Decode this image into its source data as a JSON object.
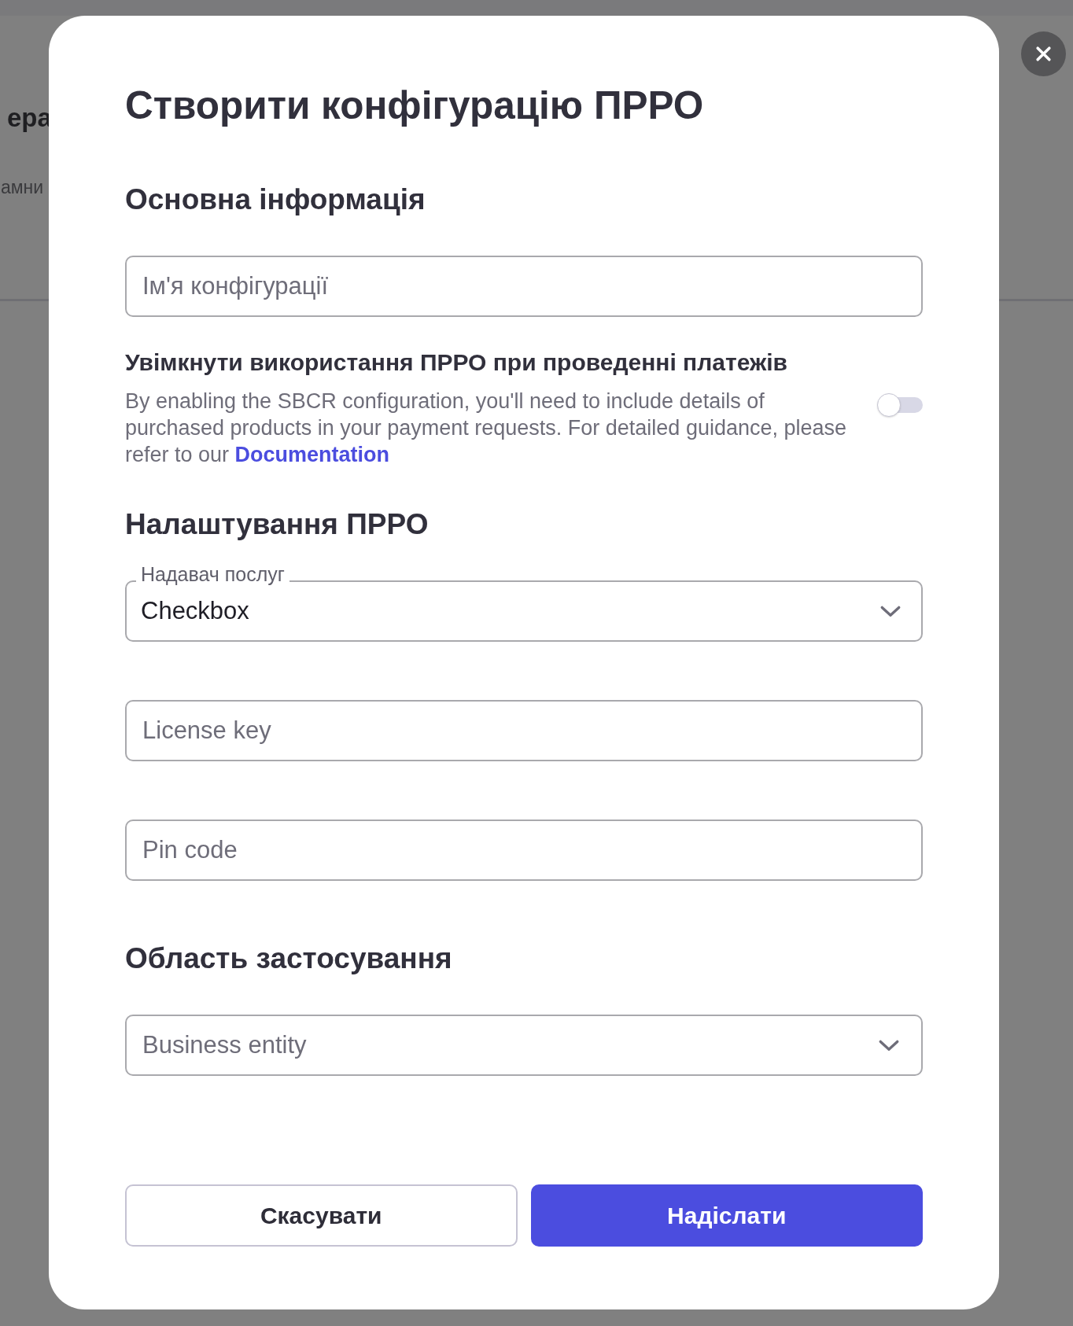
{
  "background_page": {
    "heading": "ера",
    "text": "амни"
  },
  "modal": {
    "title": "Створити конфігурацію ПРРО",
    "sections": [
      {
        "heading": "Основна інформація",
        "items": [
          {
            "kind": "text_field",
            "placeholder": "Ім'я конфігурації"
          },
          {
            "kind": "toggle",
            "label": "Увімкнути використання ПРРО при проведенні платежів",
            "description": "By enabling the SBCR configuration, you'll need to include details of purchased products in your payment requests. For detailed guidance, please refer to our",
            "link": "Documentation",
            "on": false
          }
        ]
      },
      {
        "heading": "Налаштування ПРРО",
        "items": [
          {
            "kind": "select",
            "label": "Надавач послуг",
            "value": "Checkbox"
          },
          {
            "kind": "text_field",
            "placeholder": "License key"
          },
          {
            "kind": "text_field",
            "placeholder": "Pin code"
          }
        ]
      },
      {
        "heading": "Область застосування",
        "items": [
          {
            "kind": "select",
            "placeholder": "Business entity"
          }
        ]
      }
    ],
    "buttons": [
      {
        "kind": "secondary",
        "label": "Скасувати"
      },
      {
        "kind": "primary",
        "label": "Надіслати"
      }
    ]
  }
}
